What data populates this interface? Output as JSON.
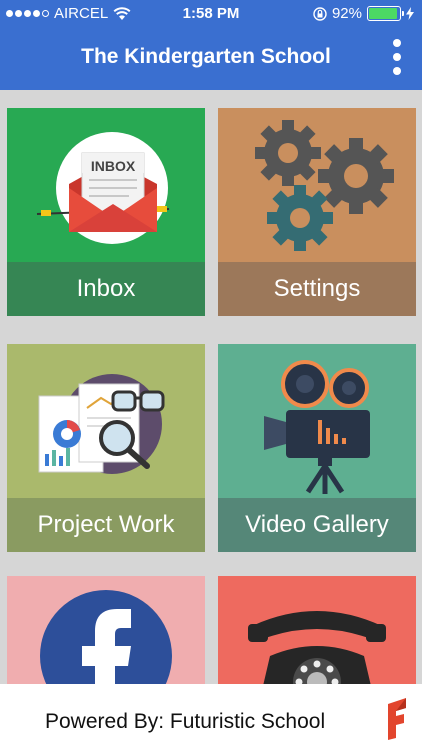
{
  "status_bar": {
    "carrier": "AIRCEL",
    "time": "1:58 PM",
    "battery": "92%",
    "battery_level": 0.92,
    "icons": [
      "signal-dots-icon",
      "wifi-icon",
      "orientation-lock-icon",
      "battery-icon",
      "charging-bolt-icon"
    ]
  },
  "header": {
    "title": "The Kindergarten School",
    "menu_icon": "more-vertical-icon"
  },
  "tiles": [
    {
      "label": "Inbox",
      "icon": "inbox-envelope-icon",
      "bg": "#28a953",
      "label_bg": "#368654",
      "art_text": "INBOX"
    },
    {
      "label": "Settings",
      "icon": "gears-icon",
      "bg": "#c98f5e",
      "label_bg": "#9c785a"
    },
    {
      "label": "Project Work",
      "icon": "report-magnifier-icon",
      "bg": "#aab96c",
      "label_bg": "#8a9b61"
    },
    {
      "label": "Video Gallery",
      "icon": "film-camera-icon",
      "bg": "#5eaf91",
      "label_bg": "#558778"
    },
    {
      "label": "Facebook",
      "icon": "facebook-icon",
      "bg": "#f0adaf"
    },
    {
      "label": "Contact",
      "icon": "rotary-phone-icon",
      "bg": "#ee6a5f"
    }
  ],
  "footer": {
    "text": "Powered By: Futuristic School",
    "logo_icon": "futuristic-school-logo-icon"
  },
  "colors": {
    "header": "#3a6fd0",
    "background": "#d6d6d6"
  }
}
